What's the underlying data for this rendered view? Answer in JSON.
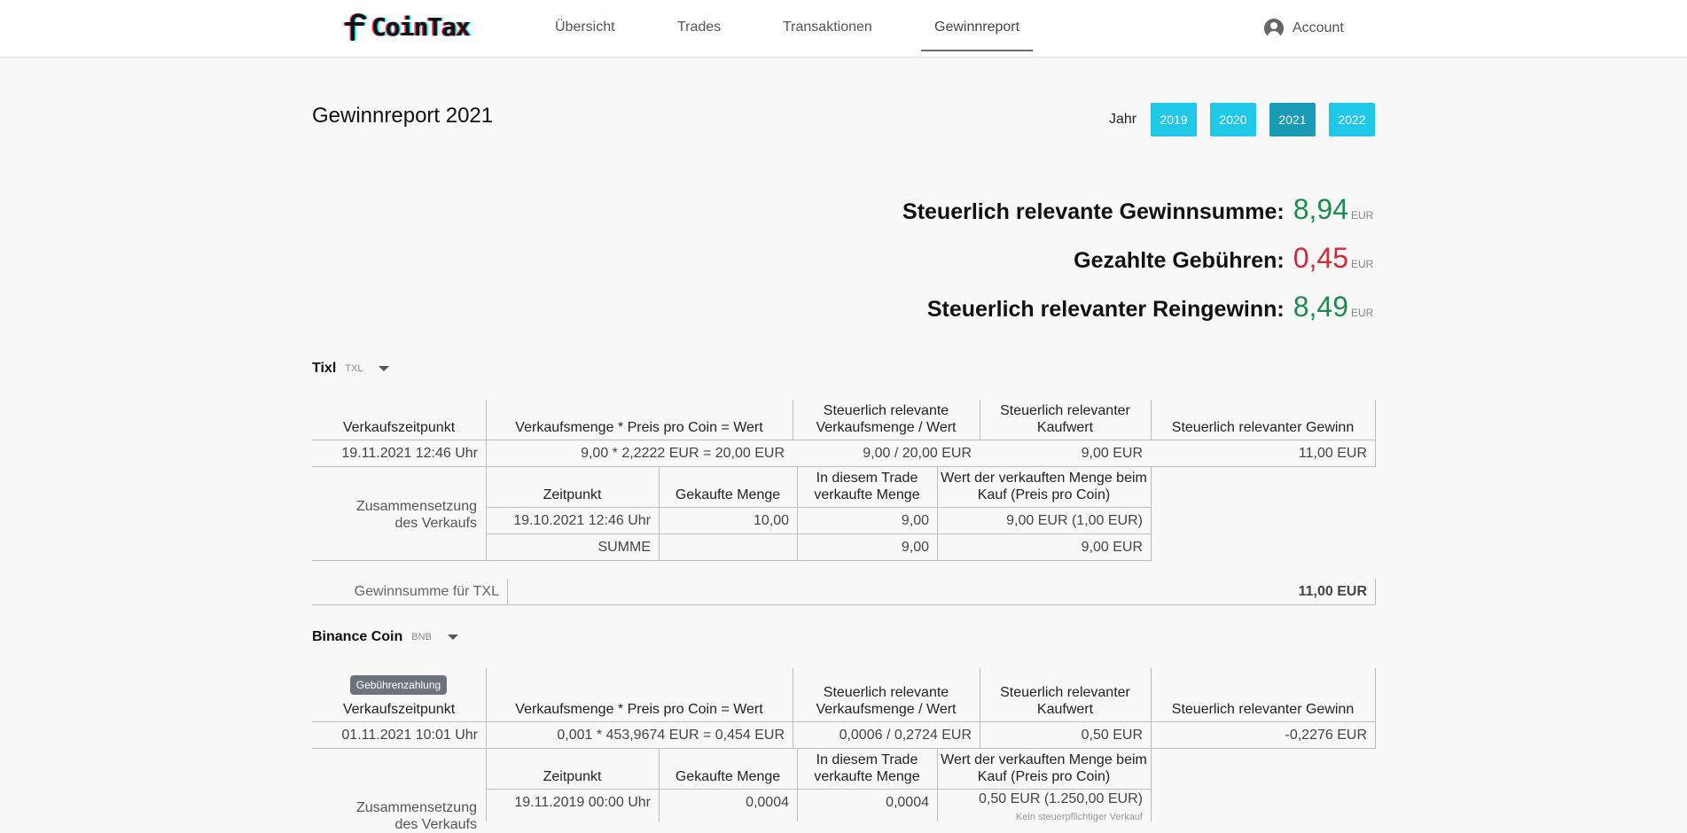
{
  "app": {
    "name": "CoinTax"
  },
  "nav": {
    "items": [
      "Übersicht",
      "Trades",
      "Transaktionen",
      "Gewinnreport"
    ],
    "active": "Gewinnreport",
    "account": "Account"
  },
  "page": {
    "title": "Gewinnreport 2021",
    "year_label": "Jahr",
    "years": [
      "2019",
      "2020",
      "2021",
      "2022"
    ],
    "selected_year": "2021"
  },
  "summary": {
    "gain_label": "Steuerlich relevante Gewinnsumme:",
    "gain_value": "8,94",
    "fees_label": "Gezahlte Gebühren:",
    "fees_value": "0,45",
    "net_label": "Steuerlich relevanter Reingewinn:",
    "net_value": "8,49",
    "unit": "EUR",
    "colors": {
      "positive": "#1e8c4e",
      "negative": "#d22a3c"
    }
  },
  "headers": {
    "sale_time": "Verkaufszeitpunkt",
    "sale_calc": "Verkaufsmenge * Preis pro Coin = Wert",
    "relevant_qty": "Steuerlich relevante Verkaufsmenge / Wert",
    "relevant_cost": "Steuerlich relevanter Kaufwert",
    "relevant_gain": "Steuerlich relevanter Gewinn",
    "composition": "Zusammensetzung des Verkaufs",
    "time": "Zeitpunkt",
    "bought_qty": "Gekaufte Menge",
    "sold_in_trade": "In diesem Trade verkaufte Menge",
    "value_at_buy": "Wert der verkauften Menge beim Kauf (Preis pro Coin)"
  },
  "coins": [
    {
      "name": "Tixl",
      "symbol": "TXL",
      "sale": {
        "time": "19.11.2021 12:46 Uhr",
        "calc": "9,00 * 2,2222 EUR = 20,00 EUR",
        "relevant": "9,00 / 20,00 EUR",
        "cost": "9,00 EUR",
        "gain": "11,00 EUR"
      },
      "composition": [
        {
          "time": "19.10.2021 12:46 Uhr",
          "bought": "10,00",
          "sold": "9,00",
          "value": "9,00 EUR (1,00 EUR)"
        }
      ],
      "sum_label": "SUMME",
      "sum_sold": "9,00",
      "sum_value": "9,00 EUR",
      "total_label": "Gewinnsumme für TXL",
      "total_value": "11,00 EUR"
    },
    {
      "name": "Binance Coin",
      "symbol": "BNB",
      "badge": "Gebührenzahlung",
      "sale": {
        "time": "01.11.2021 10:01 Uhr",
        "calc": "0,001 * 453,9674 EUR = 0,454 EUR",
        "relevant": "0,0006 / 0,2724 EUR",
        "cost": "0,50 EUR",
        "gain": "-0,2276 EUR"
      },
      "composition": [
        {
          "time": "19.11.2019 00:00 Uhr",
          "bought": "0,0004",
          "sold": "0,0004",
          "value": "0,50 EUR (1.250,00 EUR)",
          "note": "Kein steuerpflichtiger Verkauf"
        }
      ]
    }
  ]
}
